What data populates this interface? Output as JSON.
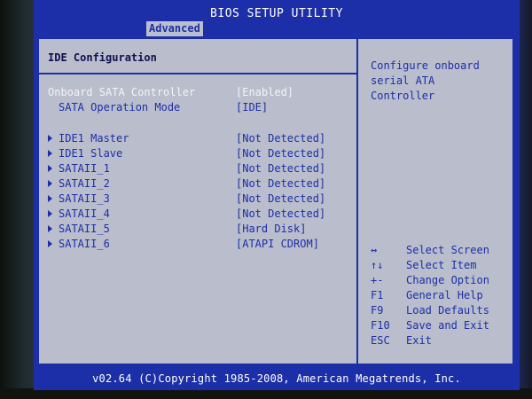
{
  "window": {
    "title": "BIOS SETUP UTILITY",
    "active_tab": "Advanced"
  },
  "section": {
    "title": "IDE Configuration"
  },
  "settings": [
    {
      "label": "Onboard SATA Controller",
      "value": "[Enabled]",
      "highlighted": true
    },
    {
      "label": "SATA Operation Mode",
      "value": "[IDE]",
      "highlighted": false
    }
  ],
  "devices": [
    {
      "label": "IDE1 Master",
      "value": "[Not Detected]"
    },
    {
      "label": "IDE1 Slave",
      "value": "[Not Detected]"
    },
    {
      "label": "SATAII_1",
      "value": "[Not Detected]"
    },
    {
      "label": "SATAII_2",
      "value": "[Not Detected]"
    },
    {
      "label": "SATAII_3",
      "value": "[Not Detected]"
    },
    {
      "label": "SATAII_4",
      "value": "[Not Detected]"
    },
    {
      "label": "SATAII_5",
      "value": "[Hard Disk]"
    },
    {
      "label": "SATAII_6",
      "value": "[ATAPI CDROM]"
    }
  ],
  "help": {
    "lines": [
      "Configure onboard",
      "serial ATA",
      "Controller"
    ]
  },
  "keys": [
    {
      "key": "↔",
      "desc": "Select Screen"
    },
    {
      "key": "↑↓",
      "desc": "Select Item"
    },
    {
      "key": "+-",
      "desc": "Change Option"
    },
    {
      "key": "F1",
      "desc": "General Help"
    },
    {
      "key": "F9",
      "desc": "Load Defaults"
    },
    {
      "key": "F10",
      "desc": "Save and Exit"
    },
    {
      "key": "ESC",
      "desc": "Exit"
    }
  ],
  "footer": {
    "text": "v02.64 (C)Copyright 1985-2008, American Megatrends, Inc."
  },
  "colors": {
    "screen_blue": "#1d2fa8",
    "panel_gray": "#b9bdcc",
    "highlight_white": "#f4f4f8"
  }
}
